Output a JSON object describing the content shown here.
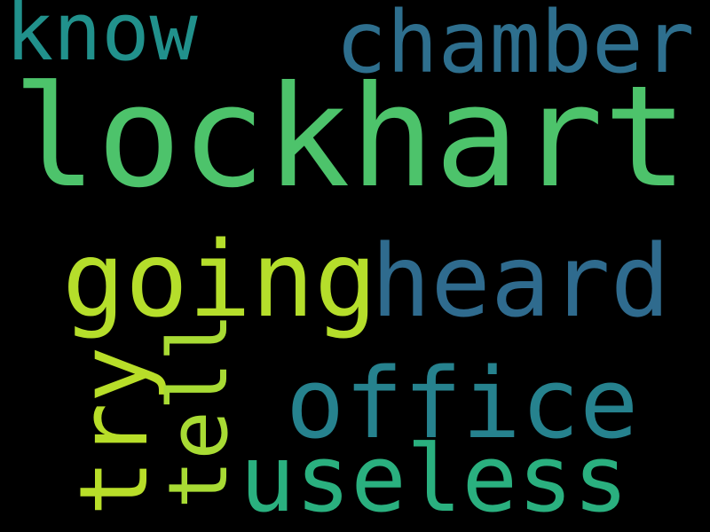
{
  "background_color": "#000000",
  "words": {
    "lockhart": {
      "text": "lockhart",
      "color": "#4dc36b"
    },
    "chamber": {
      "text": "chamber",
      "color": "#2e6f8e"
    },
    "know": {
      "text": "know",
      "color": "#21918c"
    },
    "going": {
      "text": "going",
      "color": "#b5de2b"
    },
    "heard": {
      "text": "heard",
      "color": "#2f6b8e"
    },
    "office": {
      "text": "office",
      "color": "#26828e"
    },
    "useless": {
      "text": "useless",
      "color": "#2ab07f"
    },
    "try": {
      "text": "try",
      "color": "#b8de29"
    },
    "tell": {
      "text": "tell",
      "color": "#a8db34"
    }
  }
}
